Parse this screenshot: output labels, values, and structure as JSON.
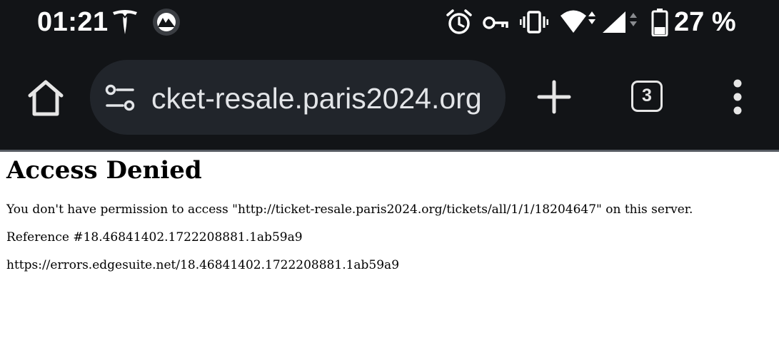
{
  "status_bar": {
    "time": "01:21",
    "battery_percent": "27 %",
    "icons": [
      "tesla-icon",
      "vpn-icon",
      "alarm-icon",
      "key-icon",
      "vibrate-icon",
      "wifi-icon",
      "cellular-signal-icon",
      "battery-icon"
    ]
  },
  "browser": {
    "url": "cket-resale.paris2024.org",
    "tab_count": "3",
    "icons": [
      "home-icon",
      "site-settings-icon",
      "plus-icon",
      "more-vert-icon"
    ]
  },
  "page": {
    "heading": "Access Denied",
    "message": "You don't have permission to access \"http://ticket-resale.paris2024.org/tickets/all/1/1/18204647\" on this server.",
    "reference": "Reference #18.46841402.1722208881.1ab59a9",
    "error_link": "https://errors.edgesuite.net/18.46841402.1722208881.1ab59a9"
  },
  "colors": {
    "chrome_background": "#121417",
    "url_bar_background": "#21252b",
    "page_background": "#ffffff"
  }
}
